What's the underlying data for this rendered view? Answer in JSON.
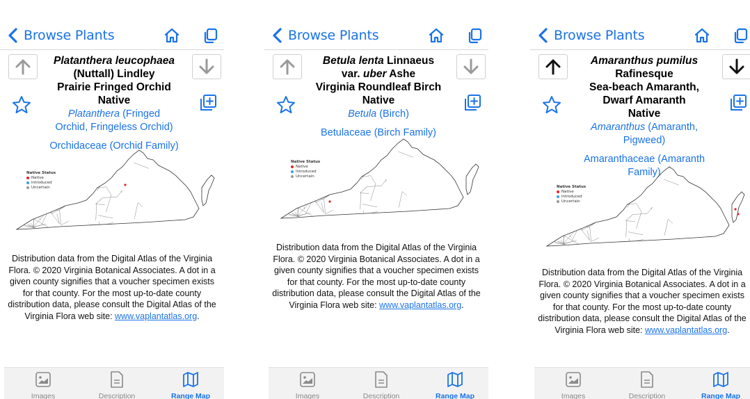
{
  "screens": [
    {
      "back_label": "Browse Plants",
      "sci_lines": [
        {
          "italic": "Platanthera leucophaea",
          "plain": ""
        },
        {
          "italic": "",
          "plain": "(Nuttall) Lindley"
        }
      ],
      "common_lines": [
        "Prairie Fringed Orchid"
      ],
      "status": "Native",
      "genus_italic": "Platanthera",
      "genus_lines": [
        " (Fringed",
        "Orchid, Fringeless Orchid)"
      ],
      "family": "Orchidaceae (Orchid Family)",
      "up_enabled": false,
      "down_enabled": false,
      "map_dots": [
        [
          188,
          279
        ]
      ]
    },
    {
      "back_label": "Browse Plants",
      "sci_lines": [
        {
          "italic": "Betula lenta",
          "plain": " Linnaeus"
        },
        {
          "italic": "",
          "plain": "var. ",
          "italic2": "uber",
          "plain2": " Ashe"
        }
      ],
      "common_lines": [
        "Virginia Roundleaf Birch"
      ],
      "status": "Native",
      "genus_italic": "Betula",
      "genus_lines": [
        " (Birch)"
      ],
      "family": "Betulaceae (Birch Family)",
      "up_enabled": false,
      "down_enabled": false,
      "map_dots": [
        [
          92,
          87
        ]
      ]
    },
    {
      "back_label": "Browse Plants",
      "sci_lines": [
        {
          "italic": "Amaranthus pumilus",
          "plain": ""
        },
        {
          "italic": "",
          "plain": "Rafinesque"
        }
      ],
      "common_lines": [
        "Sea-beach Amaranth,",
        "Dwarf Amaranth"
      ],
      "status": "Native",
      "genus_italic": "Amaranthus",
      "genus_lines": [
        " (Amaranth,",
        "Pigweed)"
      ],
      "family": "Amaranthaceae (Amaranth Family)",
      "up_enabled": true,
      "down_enabled": true,
      "map_dots": [
        [
          279,
          65
        ],
        [
          283,
          72
        ]
      ]
    }
  ],
  "legend": {
    "title": "Native Status",
    "items": [
      {
        "label": "Native",
        "color": "#e8202a"
      },
      {
        "label": "Introduced",
        "color": "#3aa0e8"
      },
      {
        "label": "Uncertain",
        "color": "#999999"
      }
    ]
  },
  "distribution": {
    "text": "Distribution data from the Digital Atlas of the Virginia Flora. © 2020 Virginia Botanical Associates. A dot in a given county signifies that a voucher specimen exists for that county. For the most up-to-date county distribution data, please consult the Digital Atlas of the Virginia Flora web site: ",
    "link": "www.vaplantatlas.org",
    "end": "."
  },
  "tabs": [
    {
      "label": "Images",
      "icon": "image-icon",
      "active": false
    },
    {
      "label": "Description",
      "icon": "document-icon",
      "active": false
    },
    {
      "label": "Range Map",
      "icon": "map-icon",
      "active": true
    }
  ],
  "colors": {
    "accent": "#1a73e8",
    "native_dot": "#e8202a"
  }
}
